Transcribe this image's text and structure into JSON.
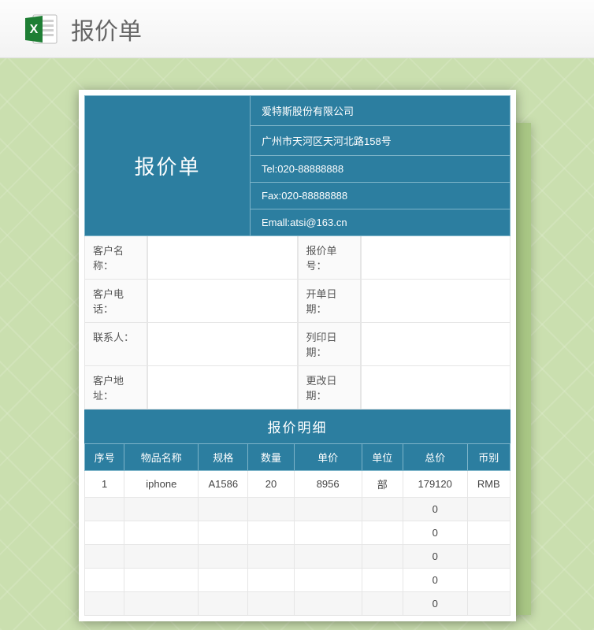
{
  "topbar": {
    "title": "报价单"
  },
  "header": {
    "title": "报价单",
    "company": "爱特斯股份有限公司",
    "address": "广州市天河区天河北路158号",
    "tel": "Tel:020-88888888",
    "fax": "Fax:020-88888888",
    "email": "Emall:atsi@163.cn"
  },
  "info": {
    "labels": {
      "customer_name": "客户名称：",
      "quote_no": "报价单号：",
      "customer_tel": "客户电话：",
      "open_date": "开单日期：",
      "contact": "联系人：",
      "print_date": "列印日期：",
      "customer_addr": "客户地址：",
      "change_date": "更改日期："
    },
    "values": {
      "customer_name": "",
      "quote_no": "",
      "customer_tel": "",
      "open_date": "",
      "contact": "",
      "print_date": "",
      "customer_addr": "",
      "change_date": ""
    }
  },
  "detail": {
    "title": "报价明细",
    "columns": [
      "序号",
      "物品名称",
      "规格",
      "数量",
      "单价",
      "单位",
      "总价",
      "币别"
    ],
    "rows": [
      [
        "1",
        "iphone",
        "A1586",
        "20",
        "8956",
        "部",
        "179120",
        "RMB"
      ],
      [
        "",
        "",
        "",
        "",
        "",
        "",
        "0",
        ""
      ],
      [
        "",
        "",
        "",
        "",
        "",
        "",
        "0",
        ""
      ],
      [
        "",
        "",
        "",
        "",
        "",
        "",
        "0",
        ""
      ],
      [
        "",
        "",
        "",
        "",
        "",
        "",
        "0",
        ""
      ],
      [
        "",
        "",
        "",
        "",
        "",
        "",
        "0",
        ""
      ]
    ]
  },
  "chart_data": {
    "type": "table",
    "title": "报价明细",
    "columns": [
      "序号",
      "物品名称",
      "规格",
      "数量",
      "单价",
      "单位",
      "总价",
      "币别"
    ],
    "rows": [
      {
        "序号": 1,
        "物品名称": "iphone",
        "规格": "A1586",
        "数量": 20,
        "单价": 8956,
        "单位": "部",
        "总价": 179120,
        "币别": "RMB"
      }
    ]
  }
}
